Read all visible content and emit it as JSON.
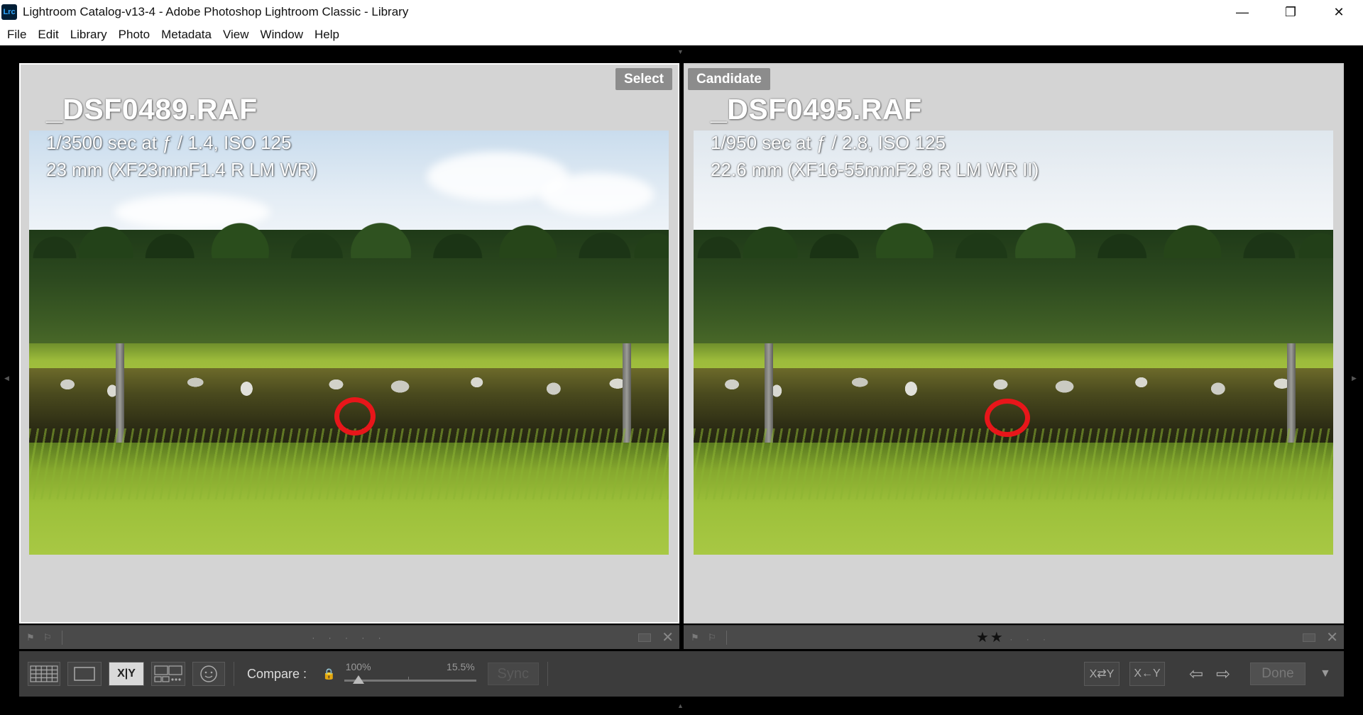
{
  "window": {
    "app_icon_label": "Lrc",
    "title": "Lightroom Catalog-v13-4 - Adobe Photoshop Lightroom Classic - Library",
    "controls": {
      "minimize": "—",
      "restore": "❐",
      "close": "✕"
    }
  },
  "menu": [
    "File",
    "Edit",
    "Library",
    "Photo",
    "Metadata",
    "View",
    "Window",
    "Help"
  ],
  "panes": {
    "select": {
      "badge": "Select",
      "filename": "_DSF0489.RAF",
      "exif_line1": "1/3500 sec at ƒ / 1.4, ISO 125",
      "exif_line2": "23 mm (XF23mmF1.4 R LM WR)",
      "rating_stars": 0,
      "rating_display": "· · · · ·"
    },
    "candidate": {
      "badge": "Candidate",
      "filename": "_DSF0495.RAF",
      "exif_line1": "1/950 sec at ƒ / 2.8, ISO 125",
      "exif_line2": "22.6 mm (XF16-55mmF2.8 R LM WR II)",
      "rating_stars": 2,
      "rating_display": "★★",
      "rating_empty": "· · ·"
    }
  },
  "strip": {
    "close": "✕"
  },
  "toolbar": {
    "compare_view_label": "X|Y",
    "compare_label": "Compare :",
    "zoom_left": "100%",
    "zoom_right": "15.5%",
    "sync_label": "Sync",
    "swap_label": "X⇄Y",
    "make_select_label": "X←Y",
    "prev_arrow": "⇦",
    "next_arrow": "⇨",
    "done_label": "Done",
    "menu_arrow": "▼"
  },
  "colors": {
    "annotation_circle": "#e8161a",
    "lr_icon_bg": "#001e36",
    "lr_icon_text": "#31a8ff"
  }
}
